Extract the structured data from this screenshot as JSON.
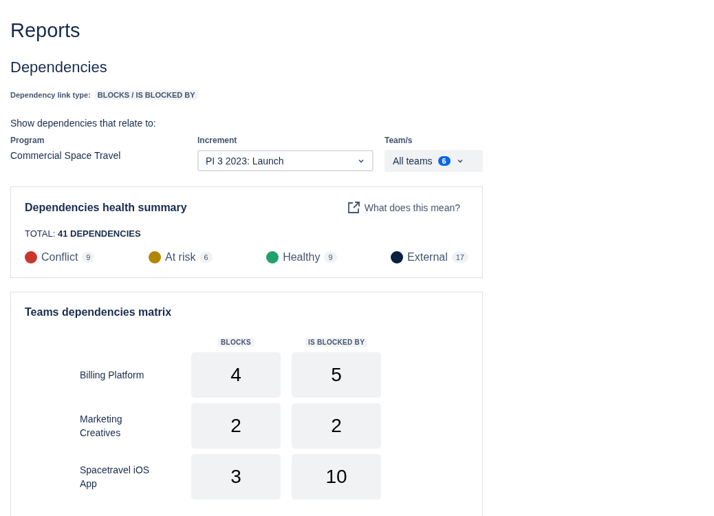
{
  "page_title": "Reports",
  "section_title": "Dependencies",
  "link_type": {
    "label": "Dependency link type:",
    "value": "BLOCKS / IS BLOCKED BY"
  },
  "filters_intro": "Show dependencies that relate to:",
  "filters": {
    "program": {
      "label": "Program",
      "value": "Commercial Space Travel"
    },
    "increment": {
      "label": "Increment",
      "value": "PI 3 2023: Launch"
    },
    "teams": {
      "label": "Team/s",
      "value": "All teams",
      "count": "6"
    }
  },
  "health_summary": {
    "title": "Dependencies health summary",
    "help_link": "What does this mean?",
    "total_label": "TOTAL:",
    "total_value": "41 DEPENDENCIES",
    "statuses": [
      {
        "label": "Conflict",
        "count": "9",
        "color": "#c9372c"
      },
      {
        "label": "At risk",
        "count": "6",
        "color": "#b38600"
      },
      {
        "label": "Healthy",
        "count": "9",
        "color": "#22a06b"
      },
      {
        "label": "External",
        "count": "17",
        "color": "#09203f"
      }
    ]
  },
  "matrix": {
    "title": "Teams dependencies matrix",
    "columns": [
      "BLOCKS",
      "IS BLOCKED BY"
    ],
    "rows": [
      {
        "team": "Billing Platform",
        "values": [
          "4",
          "5"
        ]
      },
      {
        "team": "Marketing Creatives",
        "values": [
          "2",
          "2"
        ]
      },
      {
        "team": "Spacetravel iOS App",
        "values": [
          "3",
          "10"
        ]
      }
    ]
  }
}
